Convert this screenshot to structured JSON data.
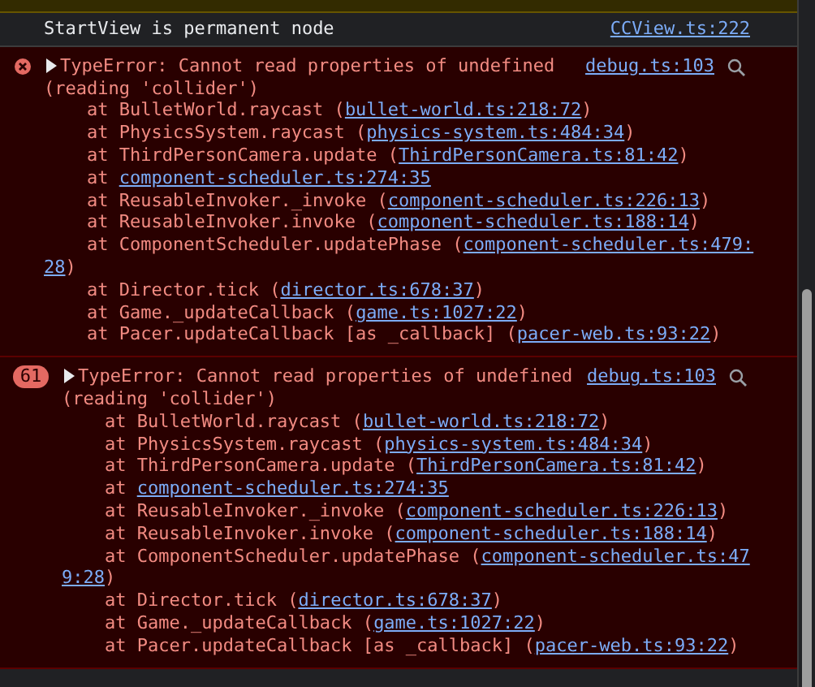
{
  "messages": [
    {
      "kind": "log",
      "text": "StartView is permanent node",
      "source": "CCView.ts:222"
    },
    {
      "kind": "error",
      "expanded": false,
      "message": "TypeError: Cannot read properties of undefined (reading 'collider')",
      "source": "debug.ts:103",
      "frames": [
        {
          "before": "at BulletWorld.raycast (",
          "link": "bullet-world.ts:218:72",
          "after": ")"
        },
        {
          "before": "at PhysicsSystem.raycast (",
          "link": "physics-system.ts:484:34",
          "after": ")"
        },
        {
          "before": "at ThirdPersonCamera.update (",
          "link": "ThirdPersonCamera.ts:81:42",
          "after": ")"
        },
        {
          "before": "at ",
          "link": "component-scheduler.ts:274:35"
        },
        {
          "before": "at ReusableInvoker._invoke (",
          "link": "component-scheduler.ts:226:13",
          "after": ")"
        },
        {
          "before": "at ReusableInvoker.invoke (",
          "link": "component-scheduler.ts:188:14",
          "after": ")"
        },
        {
          "before": "at ComponentScheduler.updatePhase (",
          "link_lines": [
            "component-scheduler.ts:479:",
            "28"
          ],
          "after": ")"
        },
        {
          "before": "at Director.tick (",
          "link": "director.ts:678:37",
          "after": ")"
        },
        {
          "before": "at Game._updateCallback (",
          "link": "game.ts:1027:22",
          "after": ")"
        },
        {
          "before": "at Pacer.updateCallback [as _callback] (",
          "link": "pacer-web.ts:93:22",
          "after": ")"
        }
      ]
    },
    {
      "kind": "error",
      "count": "61",
      "expanded": false,
      "message": "TypeError: Cannot read properties of undefined (reading 'collider')",
      "source": "debug.ts:103",
      "frames": [
        {
          "before": "at BulletWorld.raycast (",
          "link": "bullet-world.ts:218:72",
          "after": ")"
        },
        {
          "before": "at PhysicsSystem.raycast (",
          "link": "physics-system.ts:484:34",
          "after": ")"
        },
        {
          "before": "at ThirdPersonCamera.update (",
          "link": "ThirdPersonCamera.ts:81:42",
          "after": ")"
        },
        {
          "before": "at ",
          "link": "component-scheduler.ts:274:35"
        },
        {
          "before": "at ReusableInvoker._invoke (",
          "link": "component-scheduler.ts:226:13",
          "after": ")"
        },
        {
          "before": "at ReusableInvoker.invoke (",
          "link": "component-scheduler.ts:188:14",
          "after": ")"
        },
        {
          "before": "at ComponentScheduler.updatePhase (",
          "link_lines": [
            "component-scheduler.ts:47",
            "9:28"
          ],
          "after": ")"
        },
        {
          "before": "at Director.tick (",
          "link": "director.ts:678:37",
          "after": ")"
        },
        {
          "before": "at Game._updateCallback (",
          "link": "game.ts:1027:22",
          "after": ")"
        },
        {
          "before": "at Pacer.updateCallback [as _callback] (",
          "link": "pacer-web.ts:93:22",
          "after": ")"
        }
      ]
    }
  ]
}
